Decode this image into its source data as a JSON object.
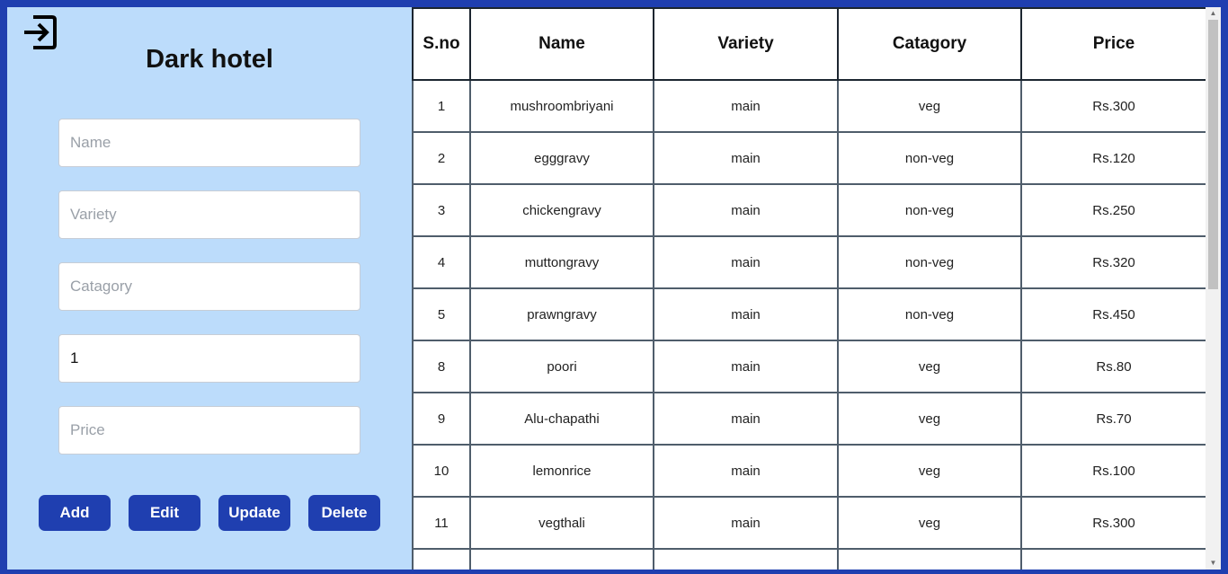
{
  "app": {
    "title": "Dark hotel"
  },
  "form": {
    "name_placeholder": "Name",
    "variety_placeholder": "Variety",
    "category_placeholder": "Catagory",
    "field4_value": "1",
    "price_placeholder": "Price"
  },
  "buttons": {
    "add": "Add",
    "edit": "Edit",
    "update": "Update",
    "delete": "Delete"
  },
  "table": {
    "headers": [
      "S.no",
      "Name",
      "Variety",
      "Catagory",
      "Price"
    ],
    "rows": [
      [
        "1",
        "mushroombriyani",
        "main",
        "veg",
        "Rs.300"
      ],
      [
        "2",
        "egggravy",
        "main",
        "non-veg",
        "Rs.120"
      ],
      [
        "3",
        "chickengravy",
        "main",
        "non-veg",
        "Rs.250"
      ],
      [
        "4",
        "muttongravy",
        "main",
        "non-veg",
        "Rs.320"
      ],
      [
        "5",
        "prawngravy",
        "main",
        "non-veg",
        "Rs.450"
      ],
      [
        "8",
        "poori",
        "main",
        "veg",
        "Rs.80"
      ],
      [
        "9",
        "Alu-chapathi",
        "main",
        "veg",
        "Rs.70"
      ],
      [
        "10",
        "lemonrice",
        "main",
        "veg",
        "Rs.100"
      ],
      [
        "11",
        "vegthali",
        "main",
        "veg",
        "Rs.300"
      ],
      [
        "",
        "",
        "",
        "",
        ""
      ]
    ]
  },
  "icons": {
    "logout": "logout-icon"
  },
  "colors": {
    "frame": "#1f3fb0",
    "panel": "#bcdcfb",
    "button": "#1f3fb0"
  }
}
